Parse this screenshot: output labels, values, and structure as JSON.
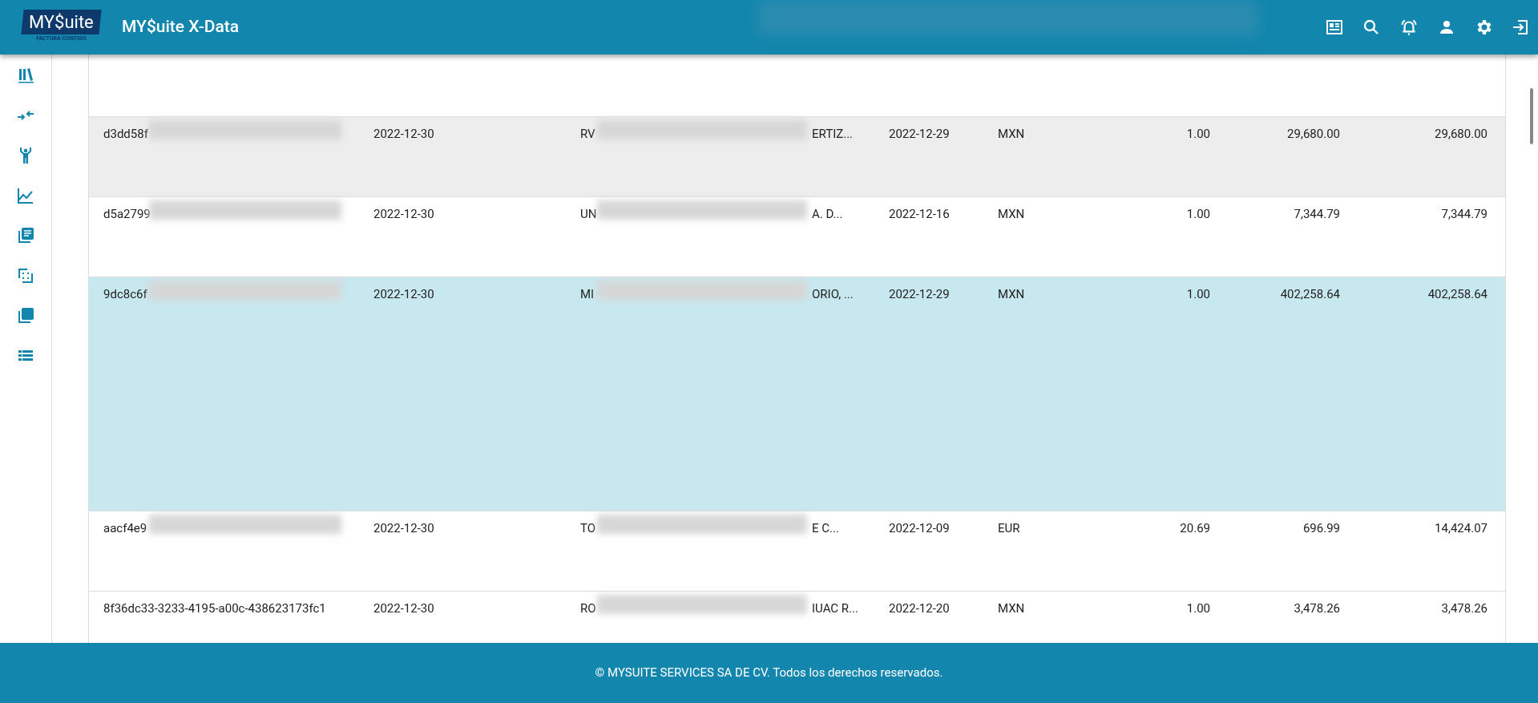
{
  "header": {
    "logo_text": "MY$uite",
    "logo_tagline": "FACTURA CONTIGO",
    "title": "MY$uite X-Data"
  },
  "rows": [
    {
      "selected": false,
      "highlighted": true,
      "cells": [
        "d3dd58f",
        "2022-12-30",
        "RV",
        "ERTIZ...",
        "2022-12-29",
        "MXN",
        "1.00",
        "29,680.00",
        "29,680.00"
      ]
    },
    {
      "selected": false,
      "highlighted": false,
      "cells": [
        "d5a2799",
        "2022-12-30",
        "UN",
        "A. D...",
        "2022-12-16",
        "MXN",
        "1.00",
        "7,344.79",
        "7,344.79"
      ]
    },
    {
      "selected": true,
      "highlighted": false,
      "cells": [
        "9dc8c6f",
        "2022-12-30",
        "MI",
        "ORIO, ...",
        "2022-12-29",
        "MXN",
        "1.00",
        "402,258.64",
        "402,258.64"
      ]
    },
    {
      "selected": false,
      "highlighted": false,
      "cells": [
        "aacf4e9",
        "2022-12-30",
        "TO",
        "E C...",
        "2022-12-09",
        "EUR",
        "20.69",
        "696.99",
        "14,424.07"
      ]
    },
    {
      "selected": false,
      "highlighted": false,
      "cells": [
        "8f36dc33-3233-4195-a00c-438623173fc1",
        "2022-12-30",
        "RO",
        "IUAC R...",
        "2022-12-20",
        "MXN",
        "1.00",
        "3,478.26",
        "3,478.26"
      ]
    }
  ],
  "footer": "© MYSUITE SERVICES SA DE CV. Todos los derechos reservados."
}
